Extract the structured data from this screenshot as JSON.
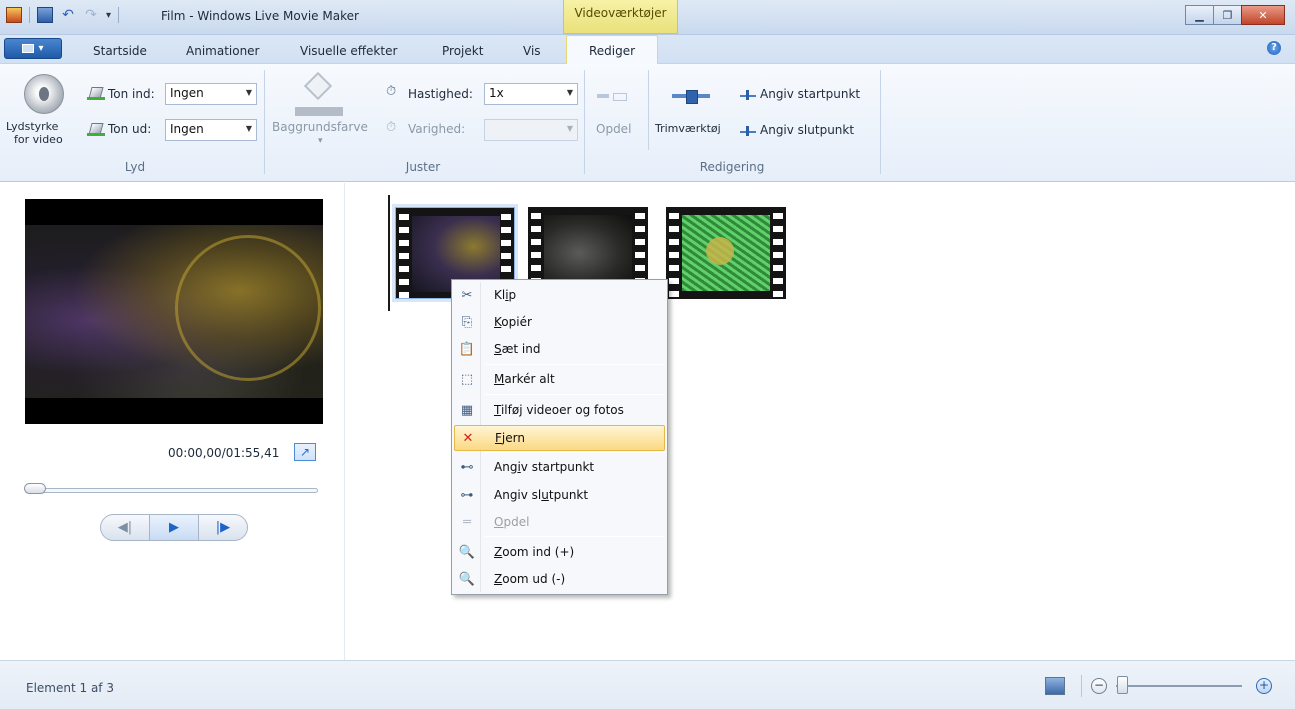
{
  "window": {
    "title": "Film - Windows Live Movie Maker",
    "context_tab_group": "Videoværktøjer",
    "controls": {
      "minimize": "▁",
      "restore": "❐",
      "close": "✕"
    }
  },
  "quick_access": {
    "undo_glyph": "↶",
    "redo_glyph": "↷",
    "dropdown_glyph": "▾"
  },
  "tabs": [
    {
      "label": "Startside",
      "active": false
    },
    {
      "label": "Animationer",
      "active": false
    },
    {
      "label": "Visuelle effekter",
      "active": false
    },
    {
      "label": "Projekt",
      "active": false
    },
    {
      "label": "Vis",
      "active": false
    },
    {
      "label": "Rediger",
      "active": true
    }
  ],
  "ribbon": {
    "audio": {
      "group_label": "Lyd",
      "volume_label_1": "Lydstyrke",
      "volume_label_2": "for video",
      "fade_in_label": "Ton ind:",
      "fade_in_value": "Ingen",
      "fade_out_label": "Ton ud:",
      "fade_out_value": "Ingen"
    },
    "adjust": {
      "group_label": "Juster",
      "background_color_label": "Baggrundsfarve",
      "speed_label": "Hastighed:",
      "speed_value": "1x",
      "duration_label": "Varighed:",
      "duration_value": ""
    },
    "editing": {
      "group_label": "Redigering",
      "split_label": "Opdel",
      "trim_label": "Trimværktøj",
      "set_start_label": "Angiv startpunkt",
      "set_end_label": "Angiv slutpunkt"
    }
  },
  "preview": {
    "timecode": "00:00,00/01:55,41",
    "seek_position": 0.0,
    "fullscreen_glyph": "↗",
    "prev_frame_glyph": "◀|",
    "play_glyph": "▶",
    "next_frame_glyph": "|▶"
  },
  "storyboard": {
    "clip_count": 3,
    "selected_clip": 1
  },
  "context_menu": {
    "items": [
      {
        "icon": "scissors-icon",
        "glyph": "✂",
        "pre": "Kl",
        "key": "i",
        "post": "p",
        "enabled": true,
        "highlighted": false
      },
      {
        "icon": "copy-icon",
        "glyph": "⎘",
        "pre": "",
        "key": "K",
        "post": "opiér",
        "enabled": true,
        "highlighted": false
      },
      {
        "icon": "paste-icon",
        "glyph": "📋",
        "pre": "",
        "key": "S",
        "post": "æt ind",
        "enabled": true,
        "highlighted": false
      },
      {
        "icon": "select-all-icon",
        "glyph": "⬚",
        "pre": "",
        "key": "M",
        "post": "arkér alt",
        "enabled": true,
        "highlighted": false
      },
      {
        "icon": "add-media-icon",
        "glyph": "▦",
        "pre": "",
        "key": "T",
        "post": "ilføj videoer og fotos",
        "enabled": true,
        "highlighted": false
      },
      {
        "icon": "remove-icon",
        "glyph": "✕",
        "pre": "",
        "key": "F",
        "post": "jern",
        "enabled": true,
        "highlighted": true
      },
      {
        "icon": "set-start-icon",
        "glyph": "⊷",
        "pre": "Ang",
        "key": "i",
        "post": "v startpunkt",
        "enabled": true,
        "highlighted": false
      },
      {
        "icon": "set-end-icon",
        "glyph": "⊶",
        "pre": "Angiv sl",
        "key": "u",
        "post": "tpunkt",
        "enabled": true,
        "highlighted": false
      },
      {
        "icon": "split-icon",
        "glyph": "═",
        "pre": "",
        "key": "O",
        "post": "pdel",
        "enabled": false,
        "highlighted": false
      },
      {
        "icon": "zoom-in-icon",
        "glyph": "🔍",
        "pre": "",
        "key": "Z",
        "post": "oom ind (+)",
        "enabled": true,
        "highlighted": false
      },
      {
        "icon": "zoom-out-icon",
        "glyph": "🔍",
        "pre": "",
        "key": "Z",
        "post": "oom ud (-)",
        "enabled": true,
        "highlighted": false
      }
    ]
  },
  "status": {
    "text": "Element 1 af 3",
    "zoom_out_glyph": "−",
    "zoom_in_glyph": "+",
    "zoom_level": 0.0
  },
  "colors": {
    "accent": "#1f5aa8",
    "context_tab": "#e9e17b",
    "highlight": "#fbd982",
    "remove_red": "#d0231a"
  }
}
